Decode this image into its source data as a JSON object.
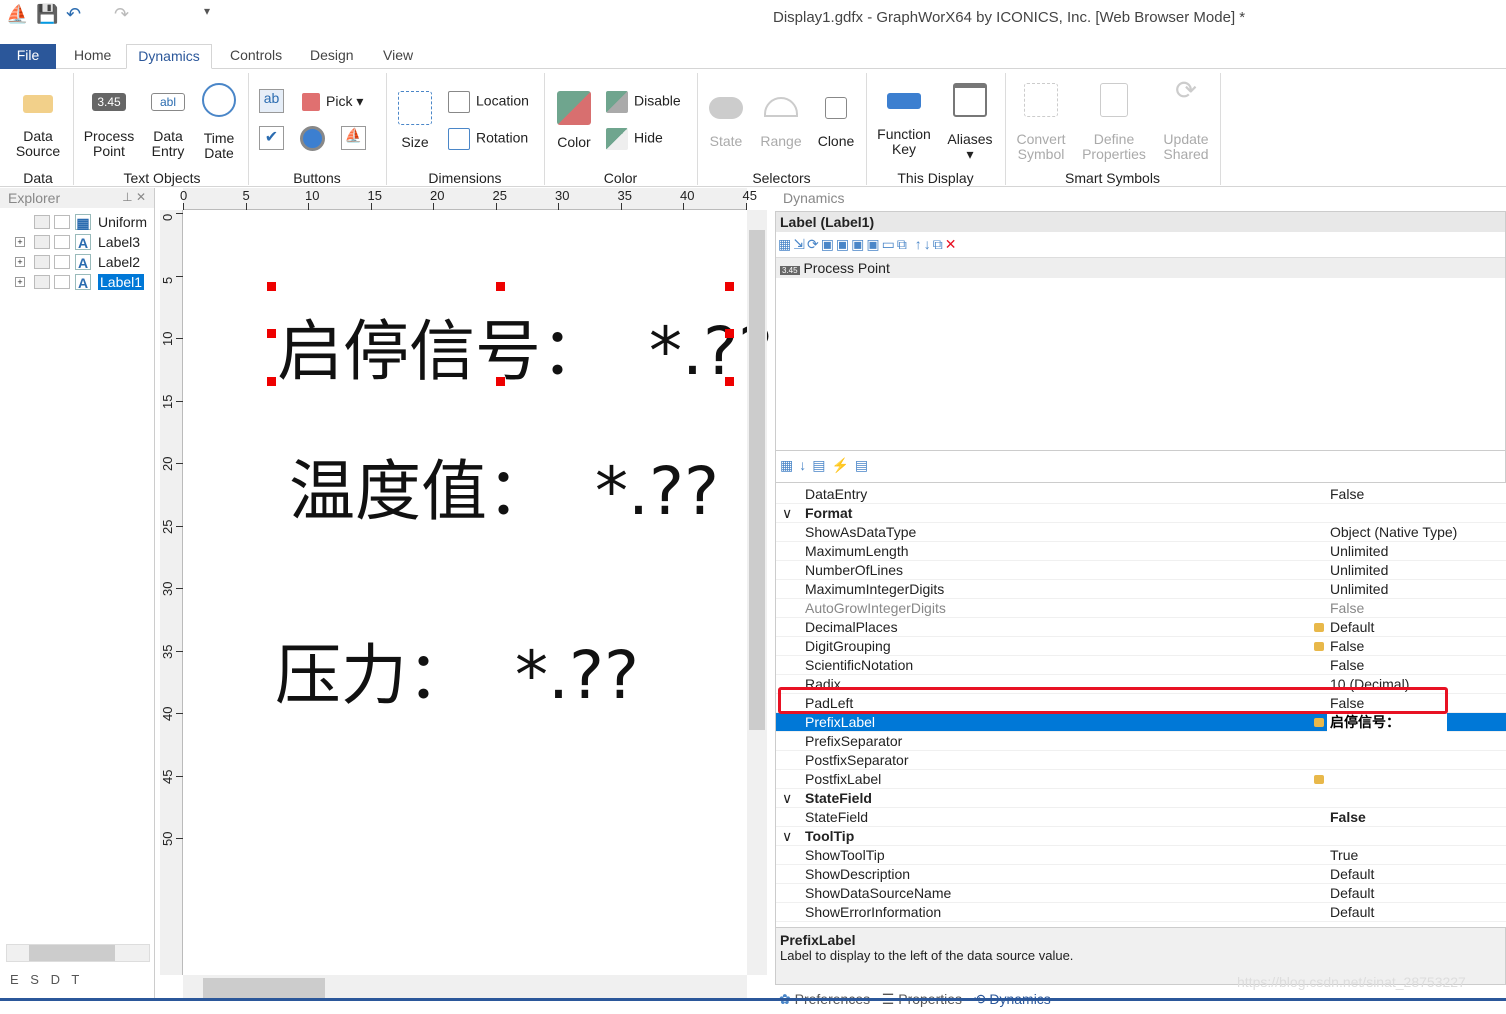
{
  "window": {
    "title": "Display1.gdfx - GraphWorX64 by ICONICS, Inc. [Web Browser Mode] *"
  },
  "tabs": [
    "File",
    "Home",
    "Dynamics",
    "Controls",
    "Design",
    "View"
  ],
  "ribbon": {
    "data_source": "Data\nSource",
    "process_point": "Process\nPoint",
    "data_entry": "Data\nEntry",
    "time_date": "Time\nDate",
    "pick": "Pick",
    "size": "Size",
    "location": "Location",
    "rotation": "Rotation",
    "color": "Color",
    "disable": "Disable",
    "hide": "Hide",
    "state": "State",
    "range": "Range",
    "clone": "Clone",
    "function_key": "Function\nKey",
    "aliases": "Aliases",
    "convert_symbol": "Convert\nSymbol",
    "define_properties": "Define\nProperties",
    "update_shared": "Update\nShared",
    "groups": [
      "Data",
      "Text Objects",
      "Buttons",
      "Dimensions",
      "Color",
      "Selectors",
      "This Display",
      "Smart Symbols"
    ],
    "process_point_icon_text": "3.45",
    "data_entry_icon_text": "abl",
    "ab_icon_text": "ab"
  },
  "explorer": {
    "title": "Explorer",
    "items": [
      {
        "label": "Uniform"
      },
      {
        "label": "Label3"
      },
      {
        "label": "Label2"
      },
      {
        "label": "Label1",
        "selected": true
      }
    ],
    "bottom_tabs": [
      "E",
      "S",
      "D",
      "T"
    ]
  },
  "ruler": {
    "top": [
      "0",
      "5",
      "10",
      "15",
      "20",
      "25",
      "30",
      "35",
      "40",
      "45"
    ],
    "left": [
      "0",
      "5",
      "10",
      "15",
      "20",
      "25",
      "30",
      "35",
      "40",
      "45",
      "50"
    ]
  },
  "canvas": {
    "labels": [
      {
        "prefix": "启停信号：",
        "value": "*.??"
      },
      {
        "prefix": "温度值：",
        "value": "*.??"
      },
      {
        "prefix": "压力：",
        "value": "*.??"
      }
    ]
  },
  "dynamics": {
    "panel_title": "Dynamics",
    "object": "Label (Label1)",
    "dynamic_item": "Process Point",
    "properties": [
      {
        "name": "DataEntry",
        "value": "False"
      },
      {
        "name": "Format",
        "category": true
      },
      {
        "name": "ShowAsDataType",
        "value": "Object (Native Type)"
      },
      {
        "name": "MaximumLength",
        "value": "Unlimited"
      },
      {
        "name": "NumberOfLines",
        "value": "Unlimited"
      },
      {
        "name": "MaximumIntegerDigits",
        "value": "Unlimited"
      },
      {
        "name": "AutoGrowIntegerDigits",
        "value": "False",
        "gray": true
      },
      {
        "name": "DecimalPlaces",
        "value": "Default",
        "marker": true
      },
      {
        "name": "DigitGrouping",
        "value": "False",
        "marker": true
      },
      {
        "name": "ScientificNotation",
        "value": "False"
      },
      {
        "name": "Radix",
        "value": "10 (Decimal)"
      },
      {
        "name": "PadLeft",
        "value": "False"
      },
      {
        "name": "PrefixLabel",
        "value": "启停信号：",
        "marker": true,
        "selected": true
      },
      {
        "name": "PrefixSeparator",
        "value": ""
      },
      {
        "name": "PostfixSeparator",
        "value": ""
      },
      {
        "name": "PostfixLabel",
        "value": "",
        "marker": true
      },
      {
        "name": "StateField",
        "category": true
      },
      {
        "name": "StateField",
        "value": "False",
        "bold": true
      },
      {
        "name": "ToolTip",
        "category": true
      },
      {
        "name": "ShowToolTip",
        "value": "True"
      },
      {
        "name": "ShowDescription",
        "value": "Default"
      },
      {
        "name": "ShowDataSourceName",
        "value": "Default"
      },
      {
        "name": "ShowErrorInformation",
        "value": "Default"
      }
    ],
    "description_title": "PrefixLabel",
    "description": "Label to display to the left of the data source value.",
    "bottom_tabs": [
      "Preferences",
      "Properties",
      "Dynamics"
    ]
  },
  "watermark": "https://blog.csdn.net/sinat_28753227",
  "colors": {
    "accent": "#2b579a",
    "selection": "#0078d7",
    "highlight_border": "#e81123"
  }
}
